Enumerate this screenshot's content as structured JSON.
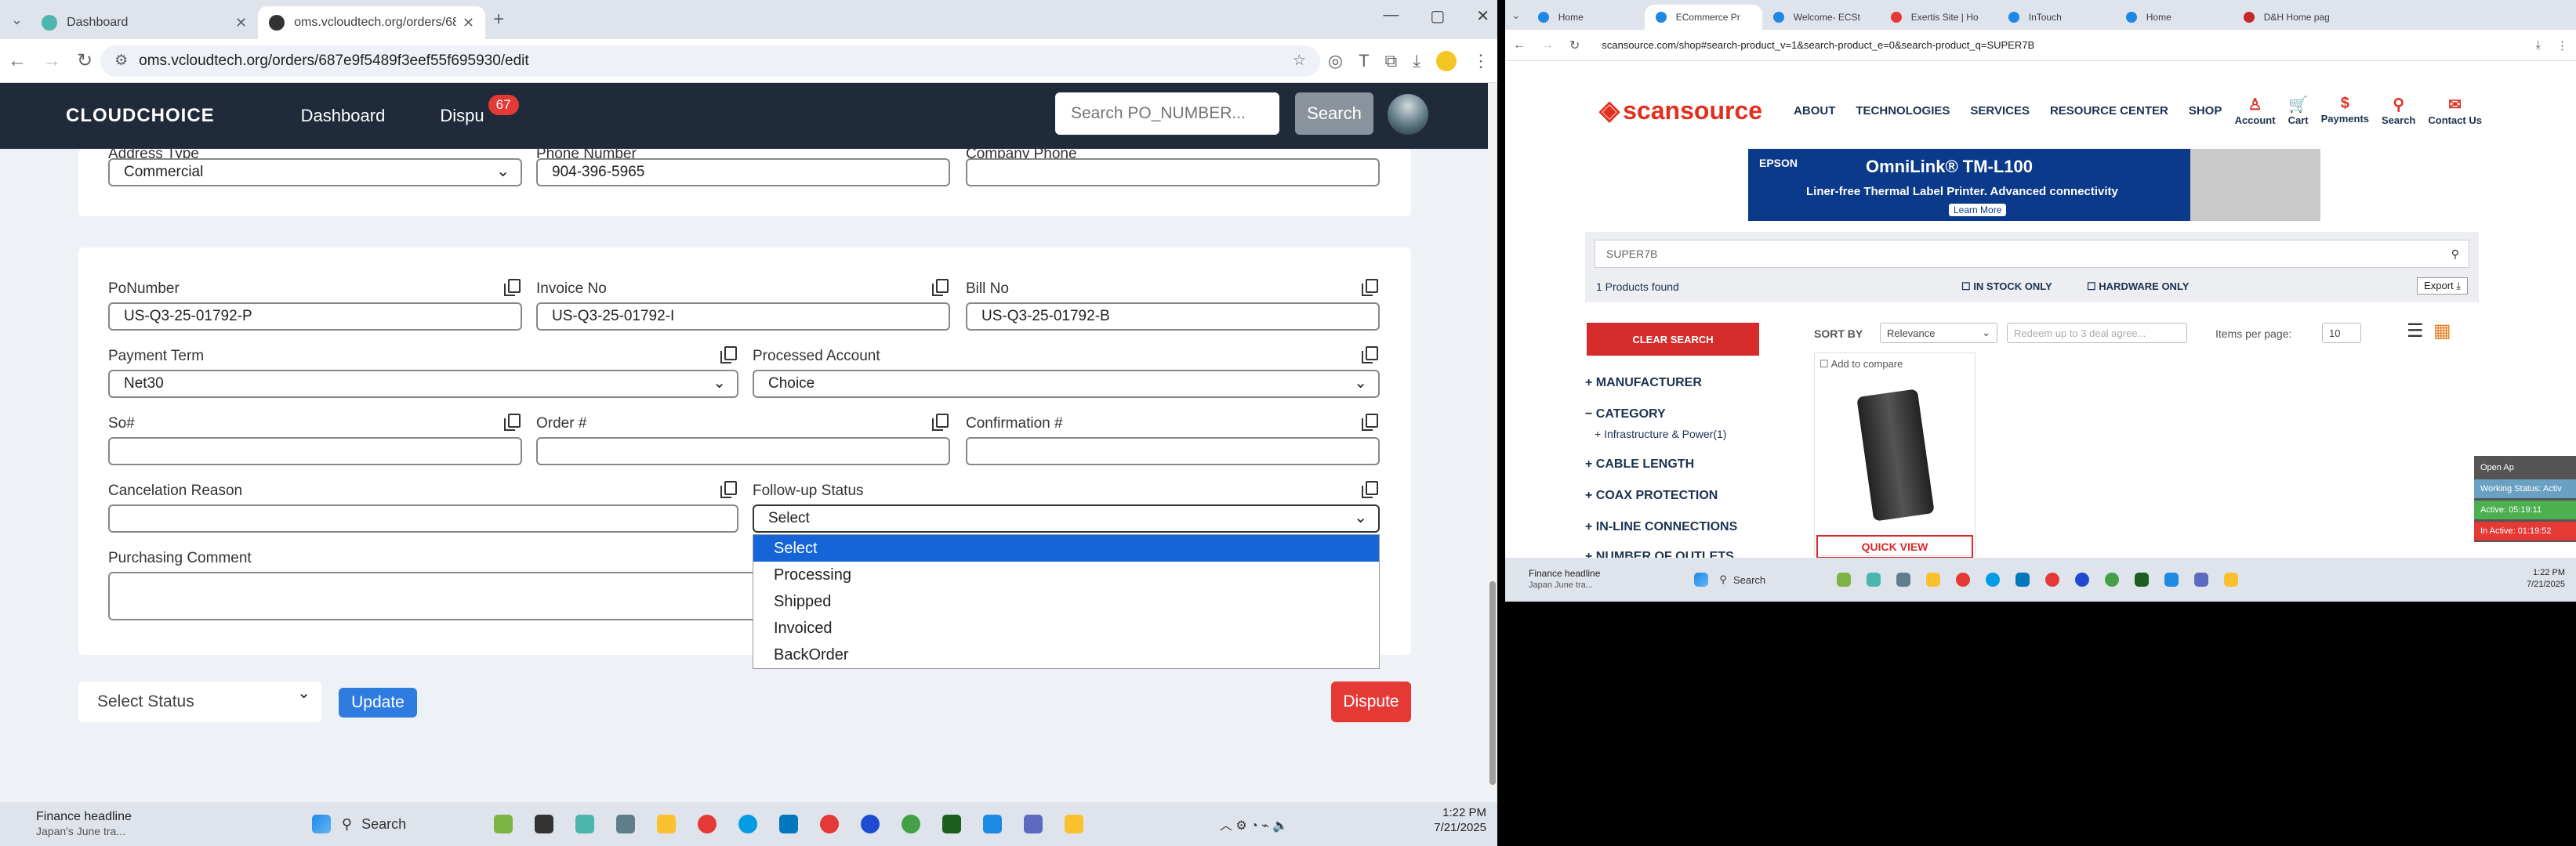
{
  "left_browser": {
    "tabs": [
      {
        "label": "Dashboard",
        "active": false
      },
      {
        "label": "oms.vcloudtech.org/orders/687",
        "active": true
      }
    ],
    "new_tab": "+",
    "url": "oms.vcloudtech.org/orders/687e9f5489f3eef55f695930/edit",
    "window_controls": [
      "—",
      "▢",
      "✕"
    ]
  },
  "oms": {
    "brand": "CLOUDCHOICE",
    "nav": {
      "dashboard": "Dashboard",
      "disputes": "Dispu",
      "dispute_count": "67"
    },
    "search_placeholder": "Search PO_NUMBER...",
    "search_button": "Search",
    "address_card": {
      "address_type_label": "Address Type",
      "address_type_value": "Commercial",
      "phone_label": "Phone Number",
      "phone_value": "904-396-5965",
      "company_phone_label": "Company Phone",
      "company_phone_value": ""
    },
    "order_card": {
      "po_label": "PoNumber",
      "po_value": "US-Q3-25-01792-P",
      "invoice_label": "Invoice No",
      "invoice_value": "US-Q3-25-01792-I",
      "bill_label": "Bill No",
      "bill_value": "US-Q3-25-01792-B",
      "payment_label": "Payment Term",
      "payment_value": "Net30",
      "processed_label": "Processed Account",
      "processed_value": "Choice",
      "so_label": "So#",
      "so_value": "",
      "order_label": "Order #",
      "order_value": "",
      "confirmation_label": "Confirmation #",
      "confirmation_value": "",
      "cancel_label": "Cancelation Reason",
      "cancel_value": "",
      "followup_label": "Follow-up Status",
      "followup_value": "Select",
      "comment_label": "Purchasing Comment",
      "comment_value": ""
    },
    "followup_options": [
      "Select",
      "Processing",
      "Shipped",
      "Invoiced",
      "BackOrder"
    ],
    "status_select": "Select Status",
    "update_button": "Update",
    "dispute_button": "Dispute"
  },
  "left_taskbar": {
    "news_title": "Finance headline",
    "news_sub": "Japan's June tra...",
    "search": "Search",
    "time": "1:22 PM",
    "date": "7/21/2025"
  },
  "right_browser": {
    "tabs": [
      "Home",
      "ECommerce Pr",
      "Welcome- ECSt",
      "Exertis Site | Ho",
      "InTouch",
      "Home",
      "D&H Home pag"
    ],
    "url": "scansource.com/shop#search-product_v=1&search-product_e=0&search-product_q=SUPER7B",
    "site": {
      "logo": "scansource",
      "nav": [
        "ABOUT",
        "TECHNOLOGIES",
        "SERVICES",
        "RESOURCE CENTER",
        "SHOP"
      ],
      "account_links": [
        "Account",
        "Cart",
        "Payments",
        "Search",
        "Contact Us"
      ],
      "ad": {
        "brand": "EPSON",
        "title": "OmniLink® TM-L100",
        "subtitle": "Liner-free Thermal Label Printer.  Advanced connectivity",
        "cta": "Learn More"
      },
      "search_query": "SUPER7B",
      "results": "1 Products found",
      "in_stock": "IN STOCK ONLY",
      "hardware_only": "HARDWARE ONLY",
      "export": "Export",
      "clear_search": "CLEAR SEARCH",
      "sort_by": "SORT BY",
      "sort_value": "Relevance",
      "deal_placeholder": "Redeem up to 3 deal agree...",
      "items_per_page": "Items per page:",
      "items_value": "10",
      "filters": [
        "MANUFACTURER",
        "CATEGORY",
        "Infrastructure & Power(1)",
        "CABLE LENGTH",
        "COAX PROTECTION",
        "IN-LINE CONNECTIONS",
        "NUMBER OF OUTLETS"
      ],
      "add_compare": "Add to compare",
      "quick_view": "QUICK VIEW",
      "side_panel": {
        "title": "Open Ap",
        "working": "Working Status: Activ",
        "active": "Active: 05:19:11",
        "inactive": "In Active: 01:19:52"
      }
    }
  },
  "right_taskbar": {
    "news_title": "Finance headline",
    "news_sub": "Japan June tra...",
    "search": "Search",
    "time": "1:22 PM",
    "date": "7/21/2025"
  }
}
